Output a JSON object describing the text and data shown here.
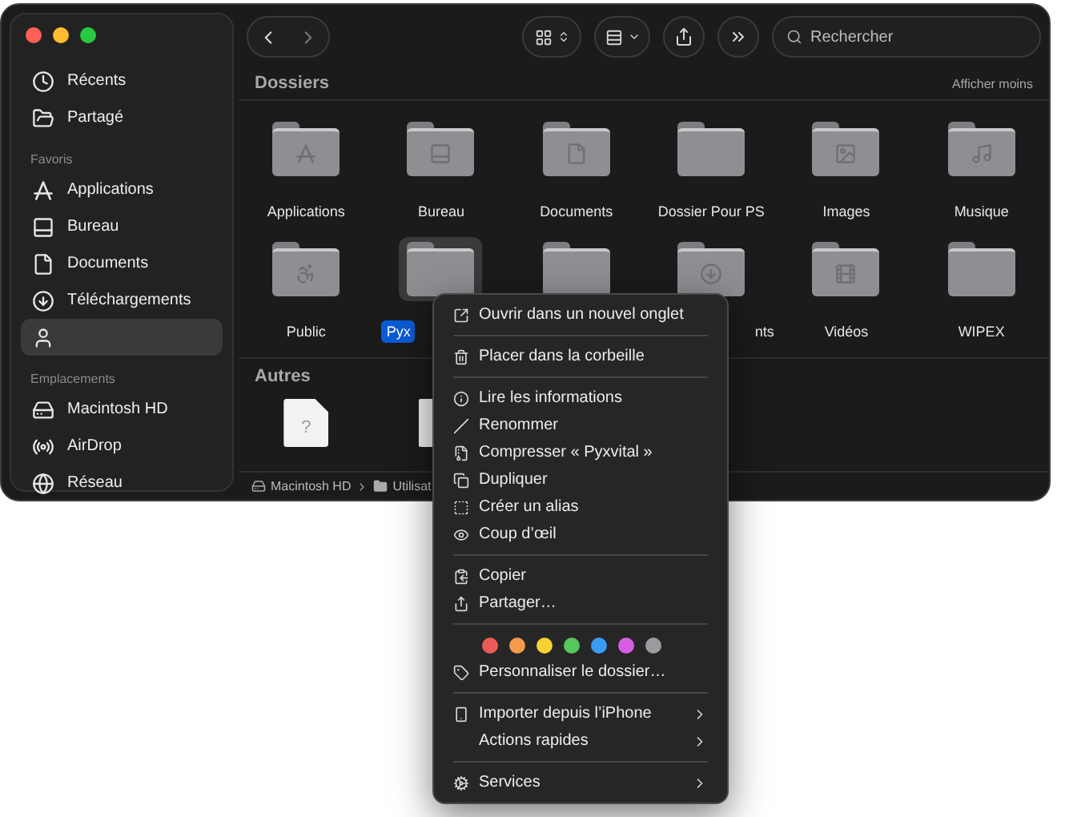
{
  "sidebar": {
    "sections": [
      {
        "items": [
          {
            "label": "Récents",
            "kind": "recent",
            "selected": false
          },
          {
            "label": "Partagé",
            "kind": "shared",
            "selected": false
          }
        ]
      },
      {
        "title": "Favoris",
        "items": [
          {
            "label": "Applications",
            "kind": "apps",
            "selected": false
          },
          {
            "label": "Bureau",
            "kind": "desktop",
            "selected": false
          },
          {
            "label": "Documents",
            "kind": "documents",
            "selected": false
          },
          {
            "label": "Téléchargements",
            "kind": "downloads",
            "selected": false
          },
          {
            "kind": "user",
            "selected": true
          }
        ]
      },
      {
        "title": "Emplacements",
        "items": [
          {
            "label": "Macintosh HD",
            "kind": "drive",
            "selected": false
          },
          {
            "label": "AirDrop",
            "kind": "airdrop",
            "selected": false
          },
          {
            "label": "Réseau",
            "kind": "network",
            "selected": false
          }
        ]
      }
    ]
  },
  "toolbar": {
    "search": {
      "placeholder": "Rechercher"
    }
  },
  "sections": [
    {
      "title": "Dossiers",
      "action": "Afficher moins",
      "items": [
        {
          "label": "Applications",
          "kind": "apps",
          "selected": false
        },
        {
          "label": "Bureau",
          "kind": "desktop",
          "selected": false
        },
        {
          "label": "Documents",
          "kind": "documents",
          "selected": false
        },
        {
          "label": "Dossier Pour PS",
          "kind": "plain",
          "selected": false
        },
        {
          "label": "Images",
          "kind": "pictures",
          "selected": false
        },
        {
          "label": "Musique",
          "kind": "music",
          "selected": false
        },
        {
          "label": "Public",
          "kind": "public",
          "selected": false
        },
        {
          "label": "Pyx",
          "kind": "plain",
          "selected": true,
          "cut_end": true
        },
        {
          "kind": "plain",
          "selected": false
        },
        {
          "label": "nts",
          "kind": "downloads",
          "selected": false,
          "cut_start": true
        },
        {
          "label": "Vidéos",
          "kind": "movies",
          "selected": false
        },
        {
          "label": "WIPEX",
          "kind": "plain",
          "selected": false
        }
      ]
    },
    {
      "title": "Autres",
      "items": [
        {
          "kind": "document",
          "glyph": "?"
        },
        {
          "kind": "document"
        }
      ]
    }
  ],
  "path_bar": [
    {
      "label": "Macintosh HD",
      "kind": "drive"
    },
    {
      "label": "Utilisat",
      "kind": "folder"
    }
  ],
  "context_menu": {
    "groups": [
      [
        {
          "label": "Ouvrir dans un nouvel onglet",
          "kind": "tab"
        }
      ],
      [
        {
          "label": "Placer dans la corbeille",
          "kind": "trash"
        }
      ],
      [
        {
          "label": "Lire les informations",
          "kind": "info"
        },
        {
          "label": "Renommer",
          "kind": "rename"
        },
        {
          "label": "Compresser « Pyxvital »",
          "kind": "archive"
        },
        {
          "label": "Dupliquer",
          "kind": "duplicate"
        },
        {
          "label": "Créer un alias",
          "kind": "alias"
        },
        {
          "label": "Coup d’œil",
          "kind": "eye"
        }
      ],
      [
        {
          "label": "Copier",
          "kind": "copy"
        },
        {
          "label": "Partager…",
          "kind": "share"
        }
      ],
      [
        {
          "kind": "tags",
          "tags": [
            {
              "color": "#ec5b57"
            },
            {
              "color": "#f39a4b"
            },
            {
              "color": "#f5d133"
            },
            {
              "color": "#55c75c"
            },
            {
              "color": "#3b9cf6"
            },
            {
              "color": "#d65fe5"
            },
            {
              "color": "#9b9b9f"
            }
          ]
        },
        {
          "label": "Personnaliser le dossier…",
          "kind": "tag"
        }
      ],
      [
        {
          "label": "Importer depuis l’iPhone",
          "kind": "phone",
          "submenu": true
        },
        {
          "label": "Actions rapides",
          "kind": "none",
          "submenu": true
        }
      ],
      [
        {
          "label": "Services",
          "kind": "services",
          "submenu": true
        }
      ]
    ]
  }
}
